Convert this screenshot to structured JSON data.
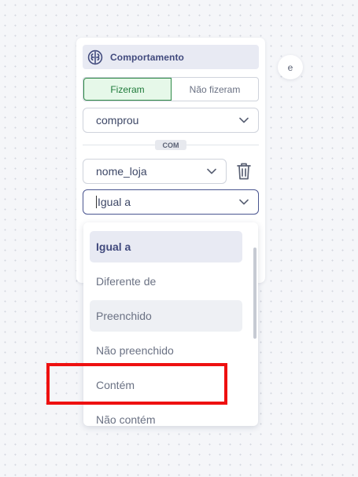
{
  "card": {
    "header": {
      "title": "Comportamento",
      "icon": "brain-icon"
    },
    "toggle": {
      "option_did": "Fizeram",
      "option_did_not": "Não fizeram",
      "selected": "Fizeram"
    },
    "event_select": {
      "value": "comprou"
    },
    "connector": "COM",
    "property_select": {
      "value": "nome_loja"
    },
    "operator_select": {
      "value": "Igual a"
    }
  },
  "and_badge": "e",
  "dropdown": {
    "options": [
      {
        "label": "Igual a",
        "state": "selected"
      },
      {
        "label": "Diferente de",
        "state": "normal"
      },
      {
        "label": "Preenchido",
        "state": "hover"
      },
      {
        "label": "Não preenchido",
        "state": "normal"
      },
      {
        "label": "Contém",
        "state": "normal"
      },
      {
        "label": "Não contém",
        "state": "normal"
      }
    ]
  },
  "colors": {
    "accent": "#414a7d",
    "toggle_active_bg": "#e6f8e9",
    "toggle_active_border": "#2f8a48",
    "highlight": "#ee1010"
  }
}
